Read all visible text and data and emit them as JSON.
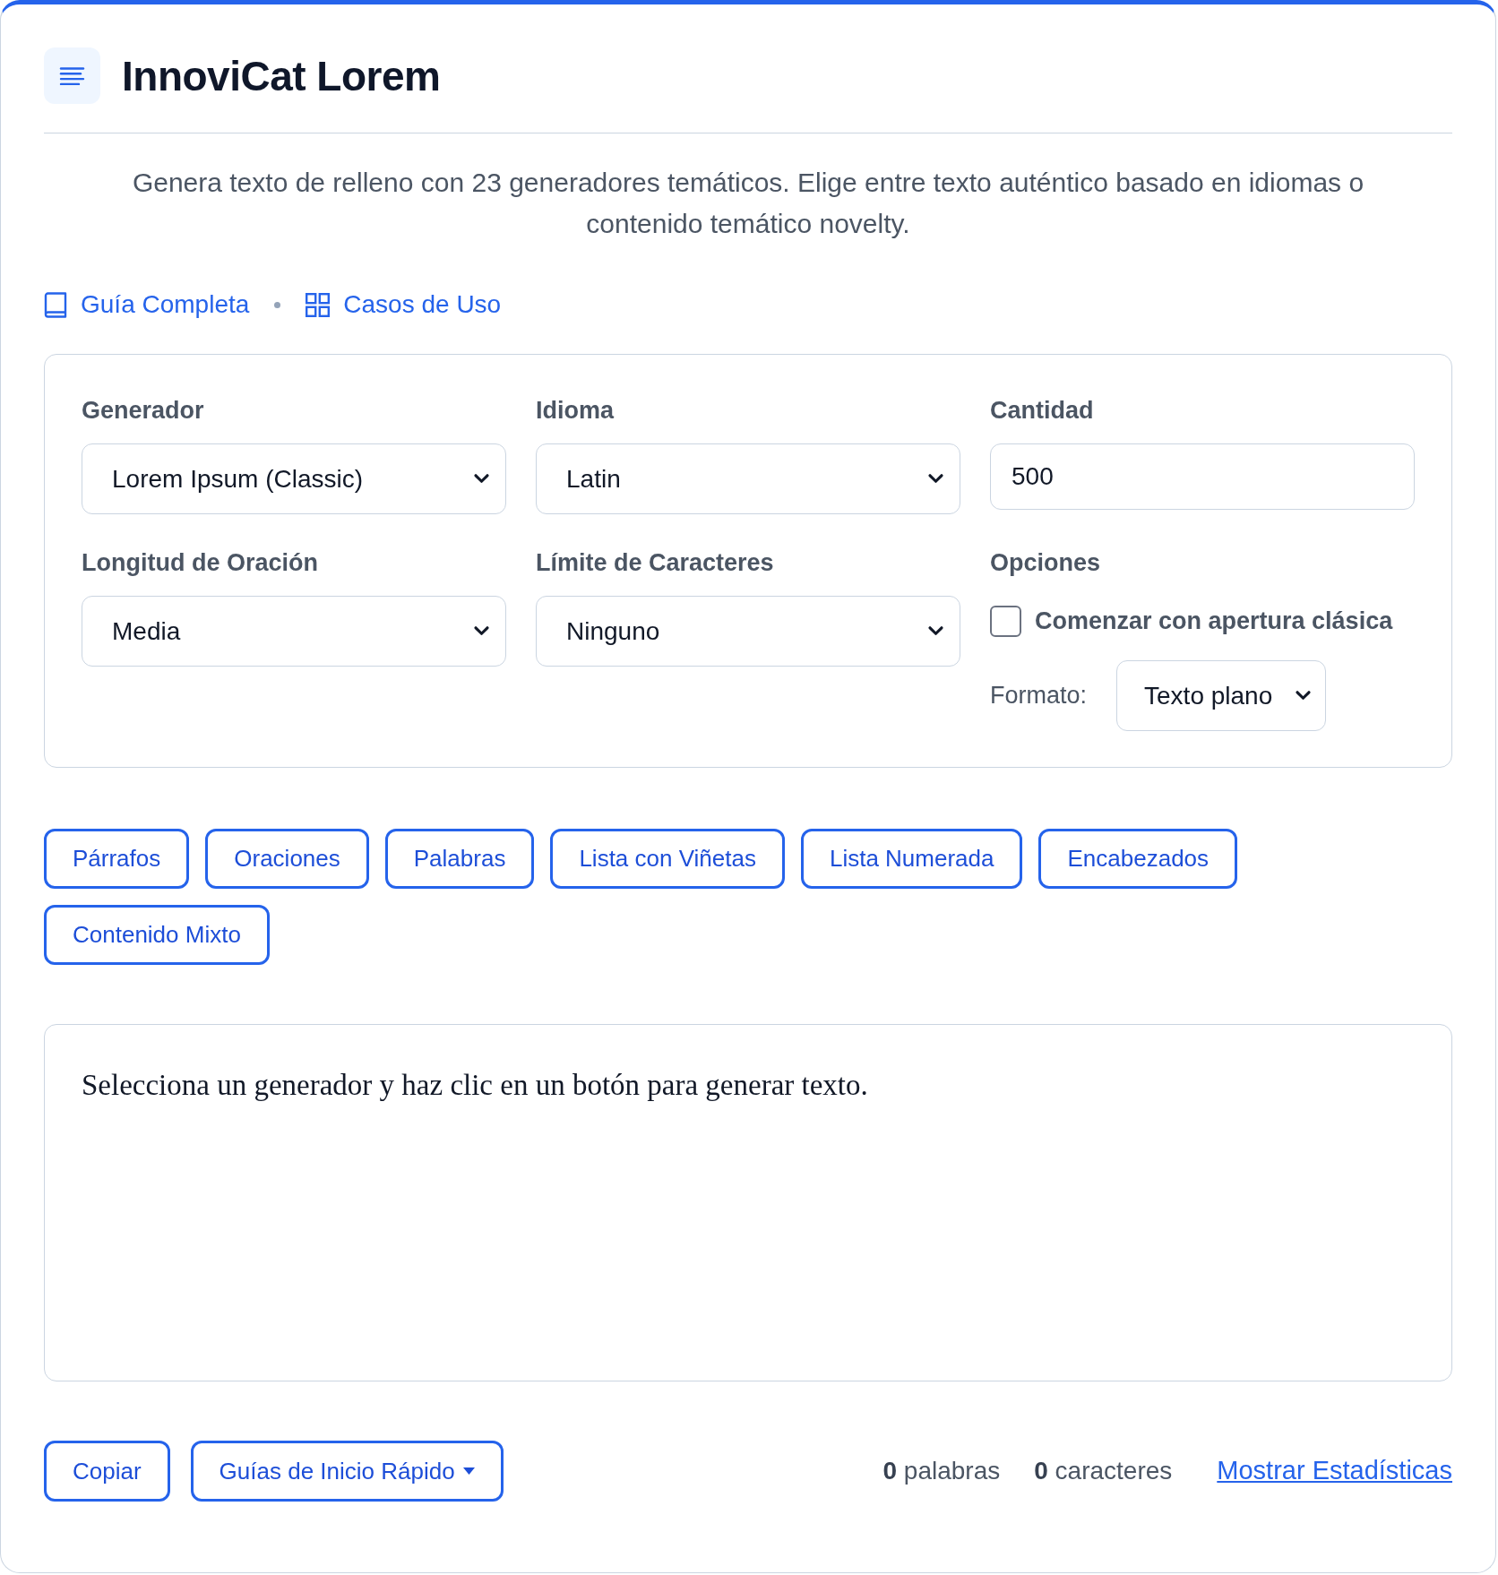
{
  "header": {
    "title": "InnoviCat Lorem"
  },
  "description": "Genera texto de relleno con 23 generadores temáticos. Elige entre texto auténtico basado en idiomas o contenido temático novelty.",
  "links": [
    {
      "label": "Guía Completa"
    },
    {
      "label": "Casos de Uso"
    }
  ],
  "settings": {
    "fields": [
      {
        "kind": "select",
        "label": "Generador",
        "value": "Lorem Ipsum (Classic)"
      },
      {
        "kind": "select",
        "label": "Idioma",
        "value": "Latin"
      },
      {
        "kind": "input",
        "label": "Cantidad",
        "value": "500"
      },
      {
        "kind": "select",
        "label": "Longitud de Oración",
        "value": "Media"
      },
      {
        "kind": "select",
        "label": "Límite de Caracteres",
        "value": "Ninguno"
      },
      {
        "kind": "options",
        "label": "Opciones",
        "checkbox": {
          "label": "Comenzar con apertura clásica",
          "checked": false
        },
        "format": {
          "label": "Formato:",
          "value": "Texto plano"
        }
      }
    ]
  },
  "format_buttons": [
    "Párrafos",
    "Oraciones",
    "Palabras",
    "Lista con Viñetas",
    "Lista Numerada",
    "Encabezados",
    "Contenido Mixto"
  ],
  "output": {
    "text": "Selecciona un generador y haz clic en un botón para generar texto."
  },
  "footer": {
    "buttons": [
      {
        "kind": "button",
        "label": "Copiar"
      },
      {
        "kind": "dropdown",
        "label": "Guías de Inicio Rápido"
      }
    ],
    "stats": [
      "**0** palabras",
      "**0** caracteres"
    ],
    "link": "Mostrar Estadísticas"
  }
}
